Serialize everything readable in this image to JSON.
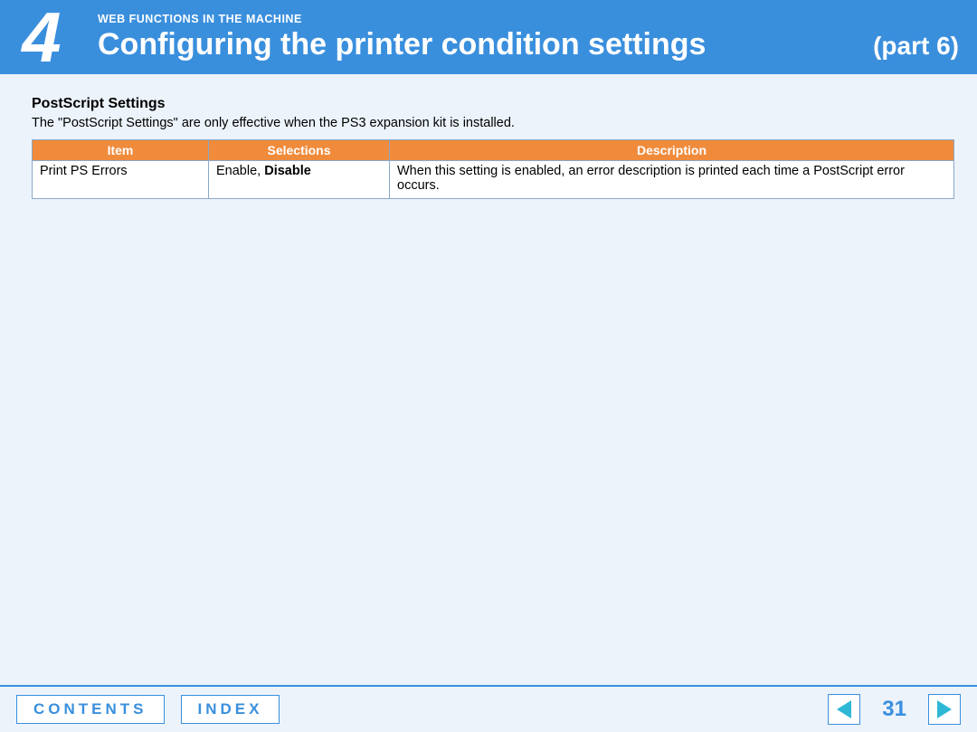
{
  "header": {
    "chapter_number": "4",
    "breadcrumb": "WEB FUNCTIONS IN THE MACHINE",
    "title": "Configuring the printer condition settings",
    "part_label": "(part 6)"
  },
  "section": {
    "heading": "PostScript Settings",
    "description": "The \"PostScript Settings\" are only effective when the PS3 expansion kit is installed."
  },
  "table": {
    "headers": {
      "item": "Item",
      "selections": "Selections",
      "description": "Description"
    },
    "row": {
      "item": "Print PS Errors",
      "sel_prefix": "Enable, ",
      "sel_bold": "Disable",
      "description": "When this setting is enabled, an error description is printed each time a PostScript error occurs."
    }
  },
  "footer": {
    "contents_label": "CONTENTS",
    "index_label": "INDEX",
    "page_number": "31"
  }
}
